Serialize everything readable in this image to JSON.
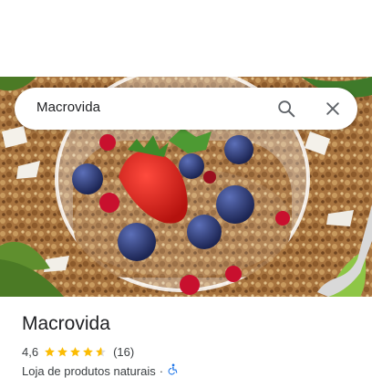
{
  "search": {
    "query": "Macrovida"
  },
  "place": {
    "name": "Macrovida",
    "rating": "4,6",
    "stars": 4.6,
    "review_count": "(16)",
    "category": "Loja de produtos naturais",
    "separator": "·"
  },
  "icons": [
    "search-icon",
    "close-icon",
    "star-icon",
    "wheelchair-icon"
  ],
  "colors": {
    "star": "#fbbc04",
    "accessibility": "#1a73e8",
    "text": "#202124"
  }
}
